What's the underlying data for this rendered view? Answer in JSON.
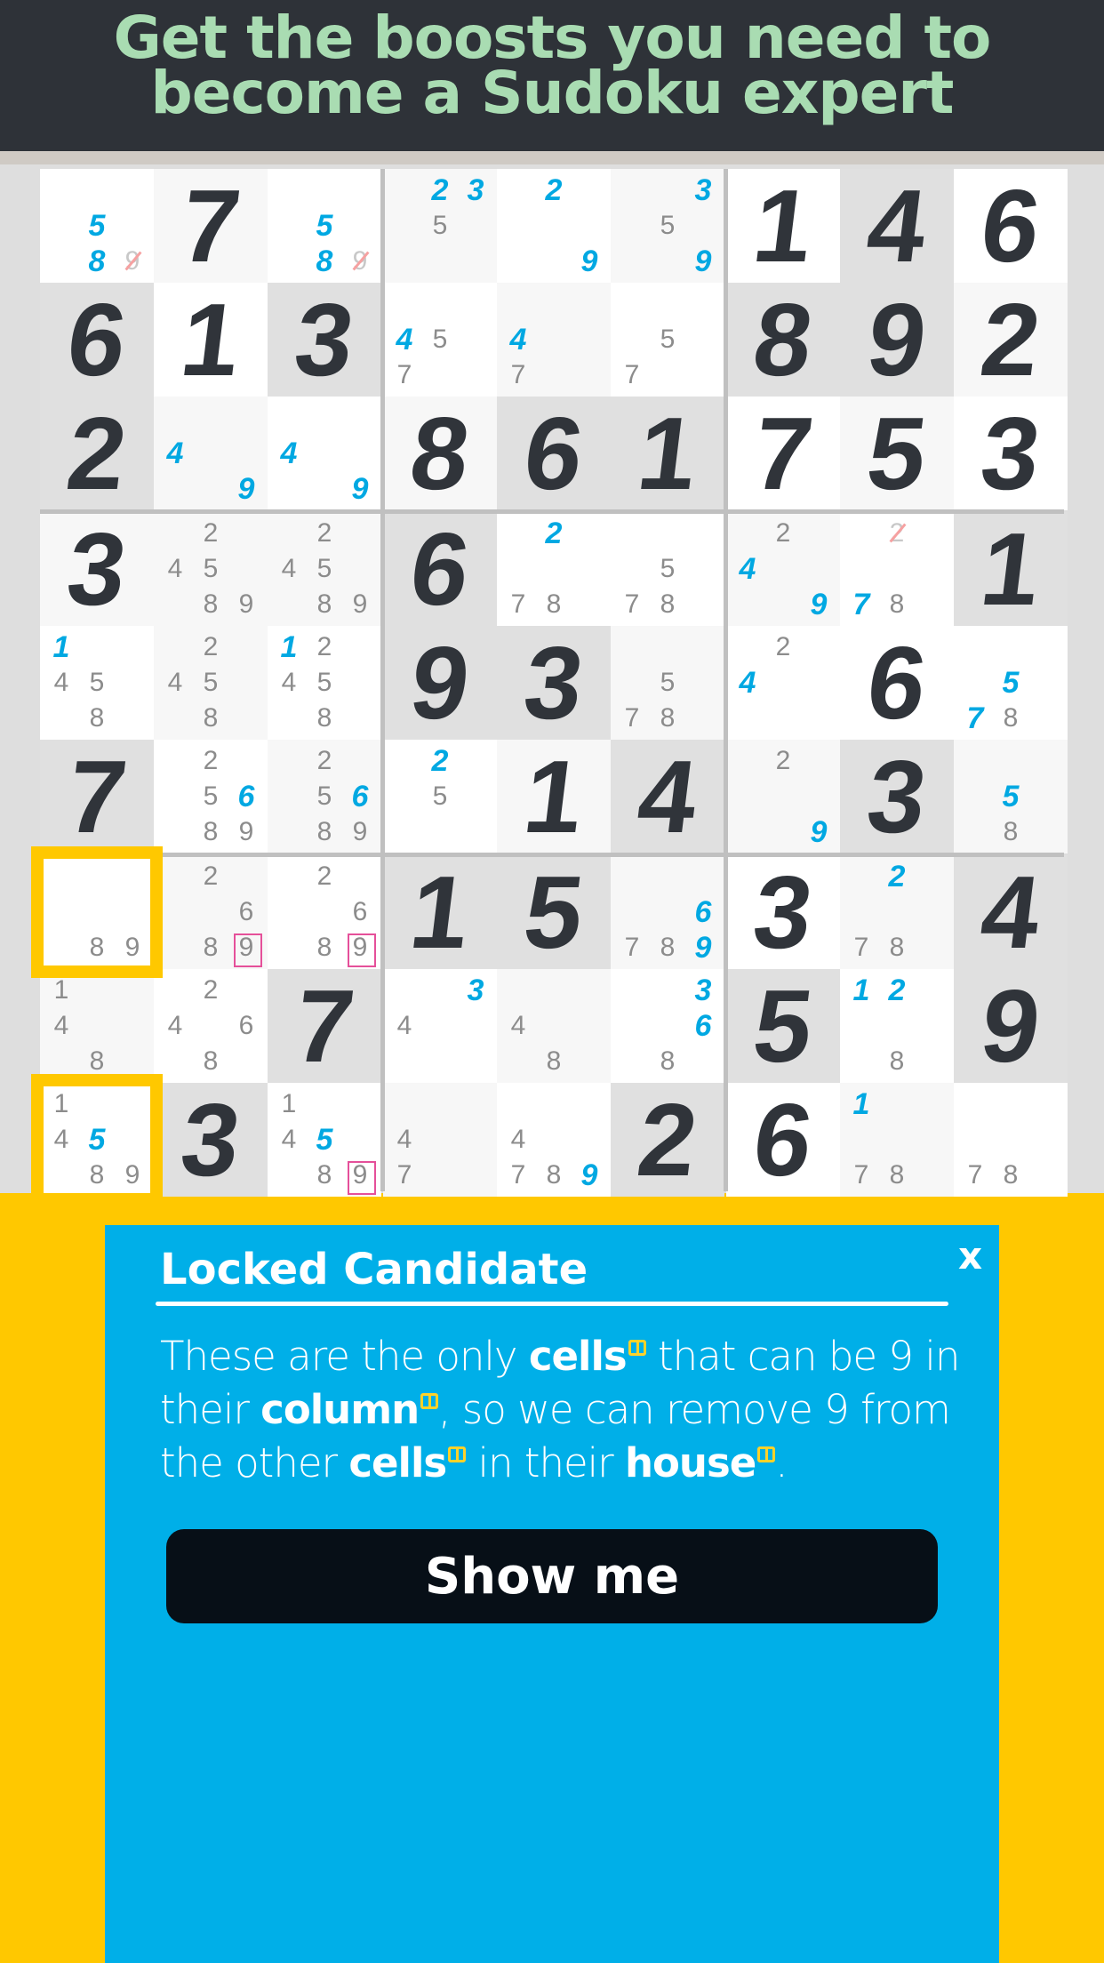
{
  "header": {
    "line1": "Get the boosts you need to",
    "line2": "become a Sudoku expert"
  },
  "colors": {
    "accent_blue": "#00afe8",
    "highlight_yellow": "#ffc800",
    "given_digit": "#30343a",
    "candidate_blue": "#00a8e2",
    "square_mark": "#e5509a",
    "header_bg": "#2e3238",
    "header_text": "#a9dcb2"
  },
  "legend": {
    "b": "blue user candidate",
    "x": "struck candidate",
    "s": "highlighted locked candidate"
  },
  "board": [
    [
      [
        "5b",
        "8b",
        "9x"
      ],
      "7",
      [
        "5b",
        "8b",
        "9x"
      ],
      [
        "2b",
        "3b",
        "5"
      ],
      [
        "2b",
        "9b"
      ],
      [
        "3b",
        "5",
        "9b"
      ],
      "1",
      "4",
      "6"
    ],
    [
      "6",
      "1",
      "3",
      [
        "4b",
        "5",
        "7"
      ],
      [
        "4b",
        "7"
      ],
      [
        "5",
        "7"
      ],
      "8",
      "9",
      "2"
    ],
    [
      "2",
      [
        "4b",
        "9b"
      ],
      [
        "4b",
        "9b"
      ],
      "8",
      "6",
      "1",
      "7",
      "5",
      "3"
    ],
    [
      "3",
      [
        "2",
        "4",
        "5",
        "8",
        "9"
      ],
      [
        "2",
        "4",
        "5",
        "8",
        "9"
      ],
      "6",
      [
        "2b",
        "7",
        "8"
      ],
      [
        "5",
        "7",
        "8"
      ],
      [
        "2",
        "4b",
        "9b"
      ],
      [
        "2x",
        "7b",
        "8"
      ],
      "1"
    ],
    [
      [
        "1b",
        "4",
        "5",
        "8"
      ],
      [
        "2",
        "4",
        "5",
        "8"
      ],
      [
        "1b",
        "2",
        "4",
        "5",
        "8"
      ],
      "9",
      "3",
      [
        "5",
        "7",
        "8"
      ],
      [
        "2",
        "4b"
      ],
      "6",
      [
        "5b",
        "7b",
        "8"
      ]
    ],
    [
      "7",
      [
        "2",
        "5",
        "6b",
        "8",
        "9"
      ],
      [
        "2",
        "5",
        "6b",
        "8",
        "9"
      ],
      [
        "2b",
        "5"
      ],
      "1",
      "4",
      [
        "2",
        "9b"
      ],
      "3",
      [
        "5b",
        "8"
      ]
    ],
    [
      [
        "8",
        "9"
      ],
      [
        "2",
        "6",
        "8",
        "9s"
      ],
      [
        "2",
        "6",
        "8",
        "9s"
      ],
      "1",
      "5",
      [
        "6b",
        "7",
        "8",
        "9b"
      ],
      "3",
      [
        "2b",
        "7",
        "8"
      ],
      "4"
    ],
    [
      [
        "1",
        "4",
        "8"
      ],
      [
        "2",
        "4",
        "6",
        "8"
      ],
      "7",
      [
        "3b",
        "4"
      ],
      [
        "4",
        "8"
      ],
      [
        "3b",
        "6b",
        "8"
      ],
      "5",
      [
        "1b",
        "2b",
        "8"
      ],
      "9"
    ],
    [
      [
        "1",
        "4",
        "5b",
        "8",
        "9"
      ],
      "3",
      [
        "1",
        "4",
        "5b",
        "8",
        "9s"
      ],
      [
        "4",
        "7"
      ],
      [
        "4",
        "7",
        "8",
        "9b"
      ],
      "2",
      "6",
      [
        "1b",
        "7",
        "8"
      ],
      [
        "7",
        "8"
      ]
    ]
  ],
  "highlighted_cells": [
    [
      6,
      0
    ],
    [
      8,
      0
    ]
  ],
  "panel": {
    "title": "Locked Candidate",
    "close_label": "x",
    "body": [
      {
        "t": "These are the only "
      },
      {
        "t": "cells",
        "b": true
      },
      {
        "t": " that can be 9 in their "
      },
      {
        "t": "column",
        "b": true
      },
      {
        "t": ", so we can remove 9 from the other "
      },
      {
        "t": "cells",
        "b": true
      },
      {
        "t": " in their "
      },
      {
        "t": "house",
        "b": true
      },
      {
        "t": "."
      }
    ],
    "button_label": "Show me"
  }
}
